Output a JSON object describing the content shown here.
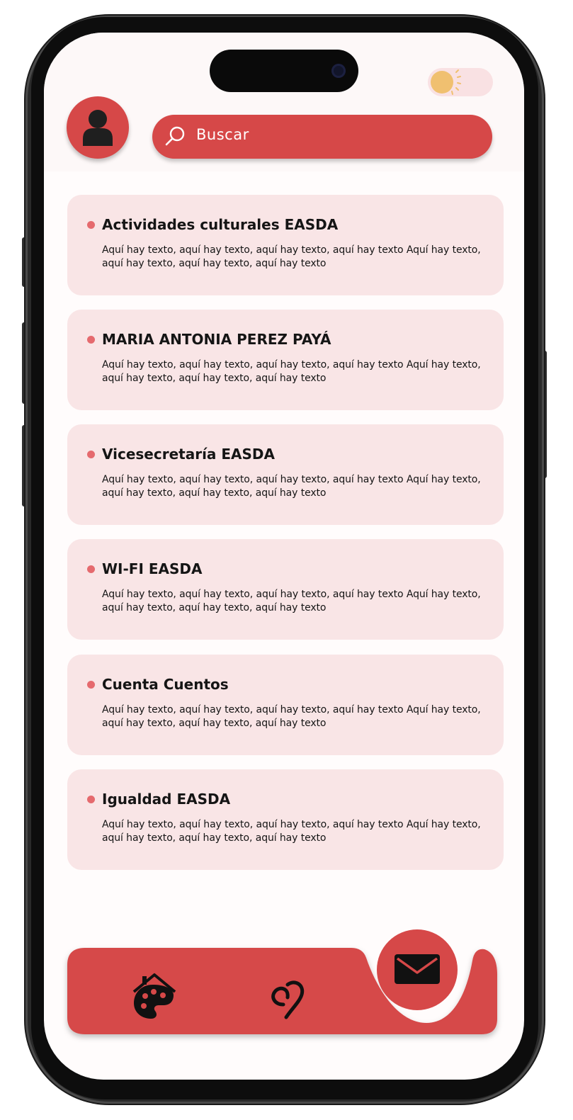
{
  "colors": {
    "accent": "#d64848",
    "card_bg": "#f9e5e6",
    "bullet": "#e56a6e",
    "toggle_bg": "#f9e1e3",
    "sun": "#f0c070"
  },
  "header": {
    "avatar_icon": "user-icon",
    "search_placeholder": "Buscar",
    "theme_toggle_icon": "sun-icon"
  },
  "items": [
    {
      "title": "Actividades culturales EASDA",
      "description": "Aquí hay texto, aquí hay texto, aquí hay texto, aquí hay texto Aquí hay texto, aquí hay texto, aquí hay texto, aquí hay texto"
    },
    {
      "title": "MARIA ANTONIA PEREZ PAYÁ",
      "description": "Aquí hay texto, aquí hay texto, aquí hay texto, aquí hay texto Aquí hay texto, aquí hay texto, aquí hay texto, aquí hay texto"
    },
    {
      "title": "Vicesecretaría EASDA",
      "description": "Aquí hay texto, aquí hay texto, aquí hay texto, aquí hay texto Aquí hay texto, aquí hay texto, aquí hay texto, aquí hay texto"
    },
    {
      "title": "WI-FI EASDA",
      "description": "Aquí hay texto, aquí hay texto, aquí hay texto, aquí hay texto Aquí hay texto, aquí hay texto, aquí hay texto, aquí hay texto"
    },
    {
      "title": "Cuenta Cuentos",
      "description": "Aquí hay texto, aquí hay texto, aquí hay texto, aquí hay texto Aquí hay texto, aquí hay texto, aquí hay texto, aquí hay texto"
    },
    {
      "title": "Igualdad EASDA",
      "description": "Aquí hay texto, aquí hay texto, aquí hay texto, aquí hay texto Aquí hay texto, aquí hay texto, aquí hay texto, aquí hay texto"
    }
  ],
  "bottom_nav": {
    "items": [
      {
        "icon": "home-palette-icon"
      },
      {
        "icon": "heart-icon"
      },
      {
        "icon": "mail-icon",
        "active": true
      }
    ]
  }
}
